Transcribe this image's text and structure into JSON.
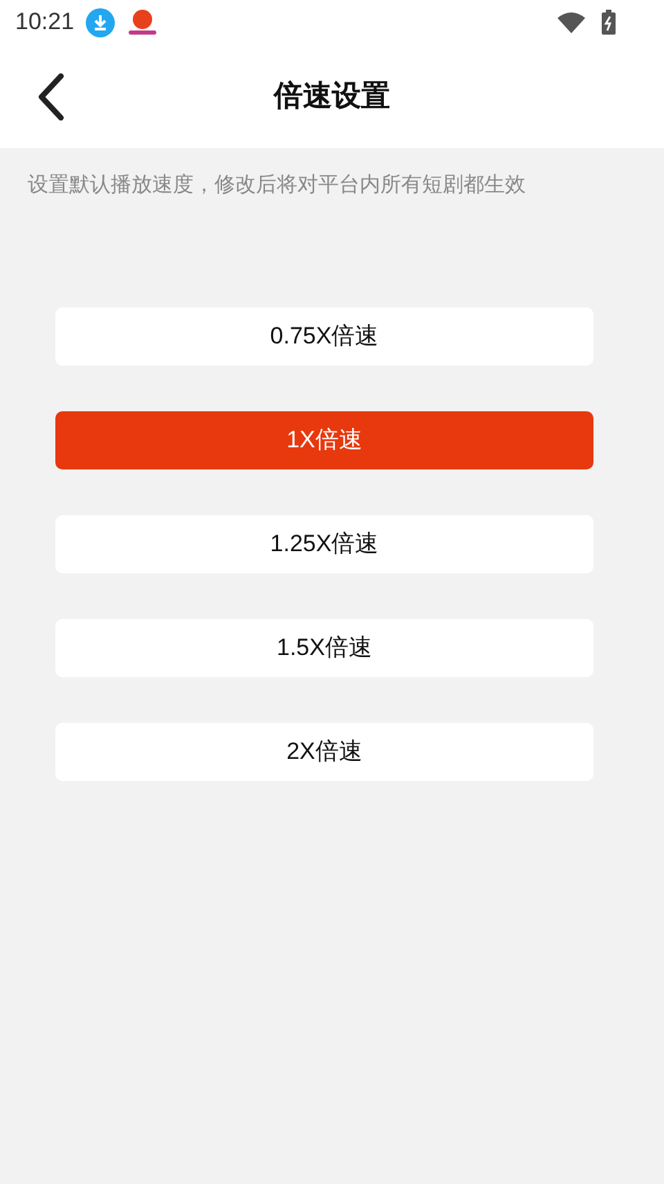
{
  "status_bar": {
    "time": "10:21"
  },
  "header": {
    "title": "倍速设置"
  },
  "hint": "设置默认播放速度，修改后将对平台内所有短剧都生效",
  "options": [
    {
      "label": "0.75X倍速",
      "selected": false
    },
    {
      "label": "1X倍速",
      "selected": true
    },
    {
      "label": "1.25X倍速",
      "selected": false
    },
    {
      "label": "1.5X倍速",
      "selected": false
    },
    {
      "label": "2X倍速",
      "selected": false
    }
  ]
}
